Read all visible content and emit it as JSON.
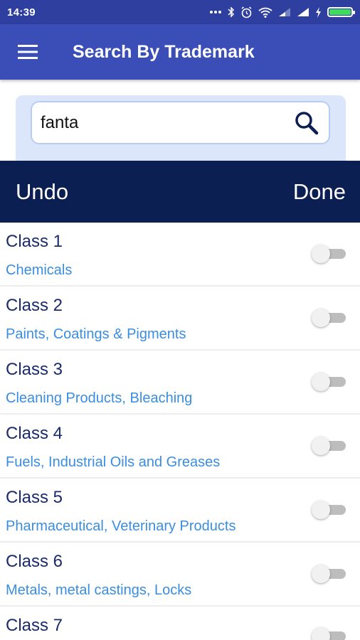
{
  "status_bar": {
    "time": "14:39",
    "icons": [
      "more-dots-icon",
      "bluetooth-icon",
      "alarm-icon",
      "wifi-icon",
      "signal-icon",
      "signal-icon",
      "charging-icon",
      "battery-icon"
    ]
  },
  "app_bar": {
    "title": "Search By Trademark",
    "menu_icon": "hamburger-menu-icon",
    "color": "#3b4db7"
  },
  "search": {
    "value": "fanta",
    "icon": "search-icon"
  },
  "actions": {
    "undo_label": "Undo",
    "done_label": "Done",
    "color": "#0b1f52"
  },
  "classes": [
    {
      "title": "Class 1",
      "description": "Chemicals",
      "enabled": false
    },
    {
      "title": "Class 2",
      "description": "Paints, Coatings & Pigments",
      "enabled": false
    },
    {
      "title": "Class 3",
      "description": "Cleaning Products, Bleaching",
      "enabled": false
    },
    {
      "title": "Class 4",
      "description": "Fuels, Industrial Oils and Greases",
      "enabled": false
    },
    {
      "title": "Class 5",
      "description": "Pharmaceutical, Veterinary Products",
      "enabled": false
    },
    {
      "title": "Class 6",
      "description": "Metals, metal castings, Locks",
      "enabled": false
    },
    {
      "title": "Class 7",
      "description": "",
      "enabled": false
    }
  ],
  "colors": {
    "class_title": "#1a2a6c",
    "class_description": "#3a8de0"
  }
}
